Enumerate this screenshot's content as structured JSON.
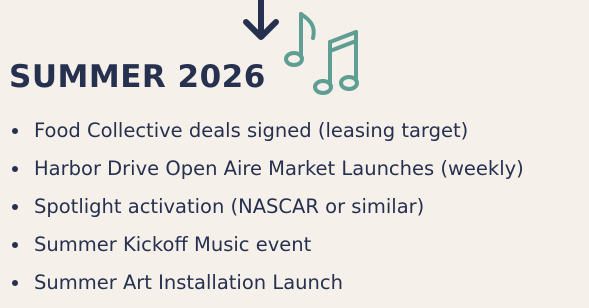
{
  "heading": "SUMMER 2026",
  "items": [
    "Food Collective deals signed (leasing target)",
    "Harbor Drive Open Aire Market Launches (weekly)",
    "Spotlight activation (NASCAR or similar)",
    "Summer Kickoff Music event",
    "Summer Art Installation Launch"
  ],
  "colors": {
    "text": "#26304f",
    "arrow": "#26304f",
    "notes": "#5f9e93",
    "background": "#f5f0ea"
  },
  "icons": {
    "arrow": "arrow-down-icon",
    "notes": "music-notes-icon"
  }
}
